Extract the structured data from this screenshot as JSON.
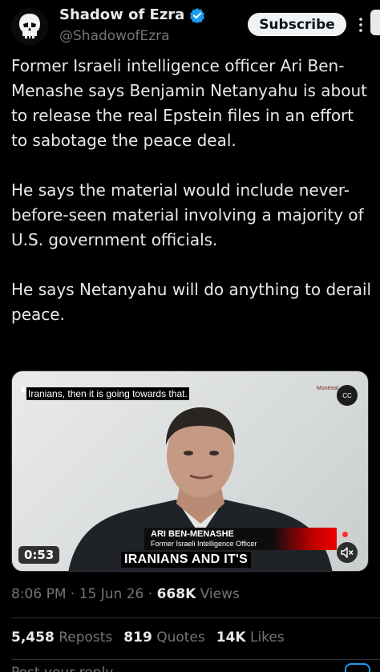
{
  "header": {
    "display_name": "Shadow of Ezra",
    "handle": "@ShadowofEzra",
    "subscribe_label": "Subscribe"
  },
  "tweet": {
    "paragraphs": [
      "Former Israeli intelligence officer Ari Ben-Menashe says Benjamin Netanyahu is about to release the real Epstein files in an effort to sabotage the peace deal.",
      "He says the material would include never-before-seen material involving a majority of U.S. government officials.",
      "He says Netanyahu will do anything to derail peace."
    ]
  },
  "video": {
    "subtitle_top": "Iranians, then it is going towards that.",
    "watermark": "Montreal",
    "cc_label": "CC",
    "lower_third_name": "ARI BEN-MENASHE",
    "lower_third_title": "Former Israeli Intelligence Officer",
    "caption": "IRANIANS AND IT'S",
    "duration": "0:53"
  },
  "meta": {
    "time": "8:06 PM",
    "date": "15 Jun 26",
    "views_count": "668K",
    "views_label": "Views"
  },
  "stats": {
    "reposts_count": "5,458",
    "reposts_label": "Reposts",
    "quotes_count": "819",
    "quotes_label": "Quotes",
    "likes_count": "14K",
    "likes_label": "Likes"
  },
  "reply": {
    "placeholder": "Post your reply"
  },
  "icons": {
    "verified": "verified-badge-icon",
    "avatar": "punisher-skull-icon",
    "more": "more-vertical-icon",
    "cc": "closed-captions-icon",
    "mute": "muted-speaker-icon"
  },
  "colors": {
    "background": "#000000",
    "text": "#e7e9ea",
    "secondary_text": "#71767b",
    "verified_blue": "#1d9bf0",
    "subscribe_bg": "#eff3f4"
  }
}
